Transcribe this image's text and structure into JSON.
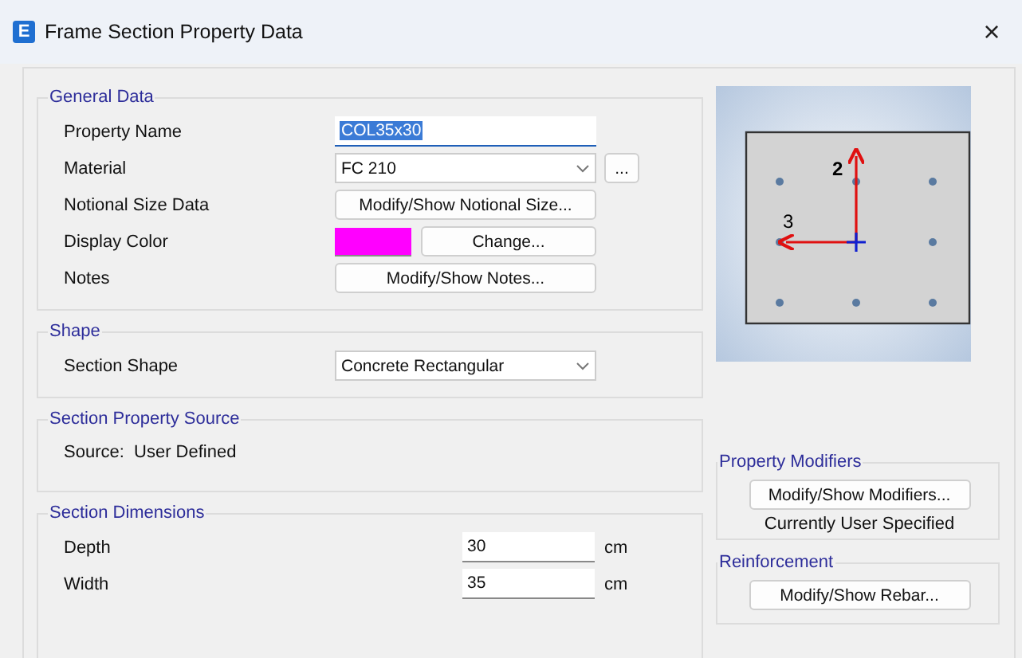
{
  "window": {
    "icon_letter": "E",
    "title": "Frame Section Property Data",
    "close": "×"
  },
  "general_data": {
    "title": "General Data",
    "rows": [
      {
        "kind": "text",
        "label": "Property Name",
        "value": "COL35x30",
        "selected": true
      },
      {
        "kind": "dropdown",
        "label": "Material",
        "value": "FC 210",
        "extra_button": "..."
      },
      {
        "kind": "button",
        "label": "Notional Size Data",
        "button": "Modify/Show Notional Size..."
      },
      {
        "kind": "color",
        "label": "Display Color",
        "color": "#ff00ff",
        "button": "Change..."
      },
      {
        "kind": "button",
        "label": "Notes",
        "button": "Modify/Show Notes..."
      }
    ]
  },
  "shape": {
    "title": "Shape",
    "label": "Section Shape",
    "value": "Concrete Rectangular"
  },
  "property_source": {
    "title": "Section Property Source",
    "text": "Source:  User Defined"
  },
  "dimensions": {
    "title": "Section Dimensions",
    "rows": [
      {
        "label": "Depth",
        "value": "30",
        "unit": "cm"
      },
      {
        "label": "Width",
        "value": "35",
        "unit": "cm"
      }
    ]
  },
  "preview": {
    "axis_2_label": "2",
    "axis_3_label": "3"
  },
  "property_modifiers": {
    "title": "Property Modifiers",
    "button": "Modify/Show Modifiers...",
    "status": "Currently User Specified"
  },
  "reinforcement": {
    "title": "Reinforcement",
    "button": "Modify/Show Rebar..."
  }
}
